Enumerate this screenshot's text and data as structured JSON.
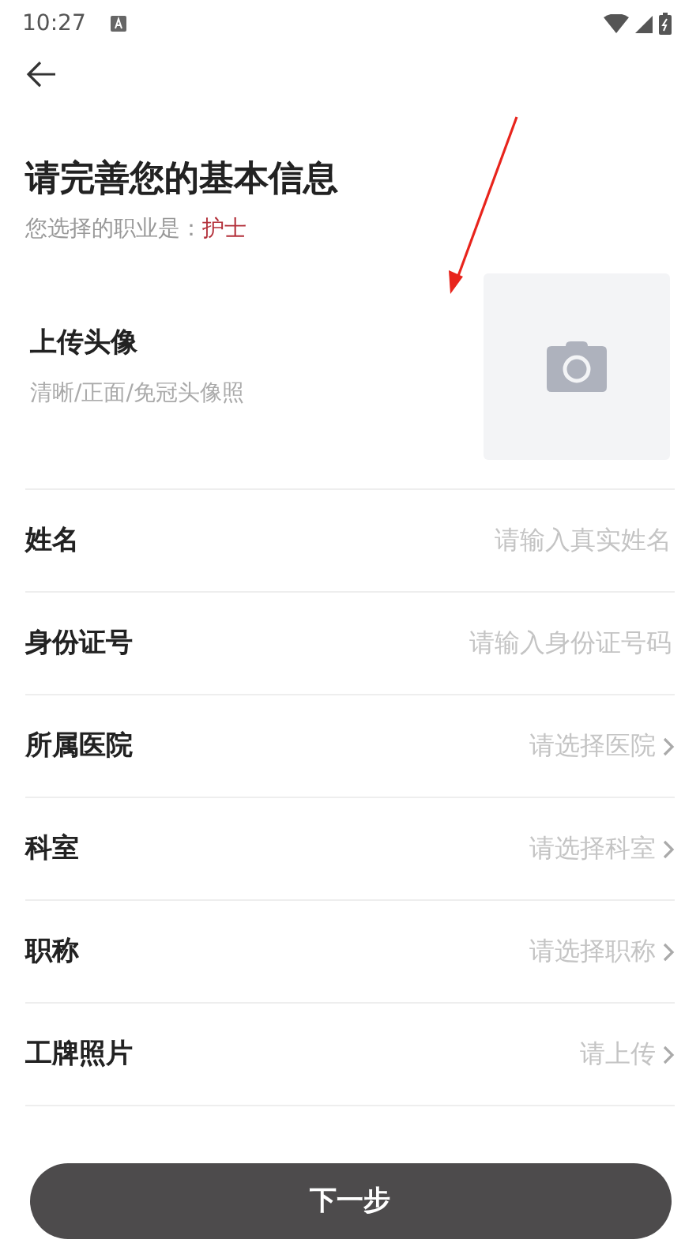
{
  "status_bar": {
    "time": "10:27"
  },
  "title": "请完善您的基本信息",
  "subtitle": {
    "label": "您选择的职业是：",
    "value": "护士"
  },
  "avatar": {
    "label": "上传头像",
    "hint": "清晰/正面/免冠头像照"
  },
  "fields": [
    {
      "kind": "input",
      "label": "姓名",
      "placeholder": "请输入真实姓名"
    },
    {
      "kind": "input",
      "label": "身份证号",
      "placeholder": "请输入身份证号码"
    },
    {
      "kind": "select",
      "label": "所属医院",
      "placeholder": "请选择医院"
    },
    {
      "kind": "select",
      "label": "科室",
      "placeholder": "请选择科室"
    },
    {
      "kind": "select",
      "label": "职称",
      "placeholder": "请选择职称"
    },
    {
      "kind": "select",
      "label": "工牌照片",
      "placeholder": "请上传"
    }
  ],
  "annotation": {
    "kind": "arrow"
  },
  "next_button": "下一步"
}
